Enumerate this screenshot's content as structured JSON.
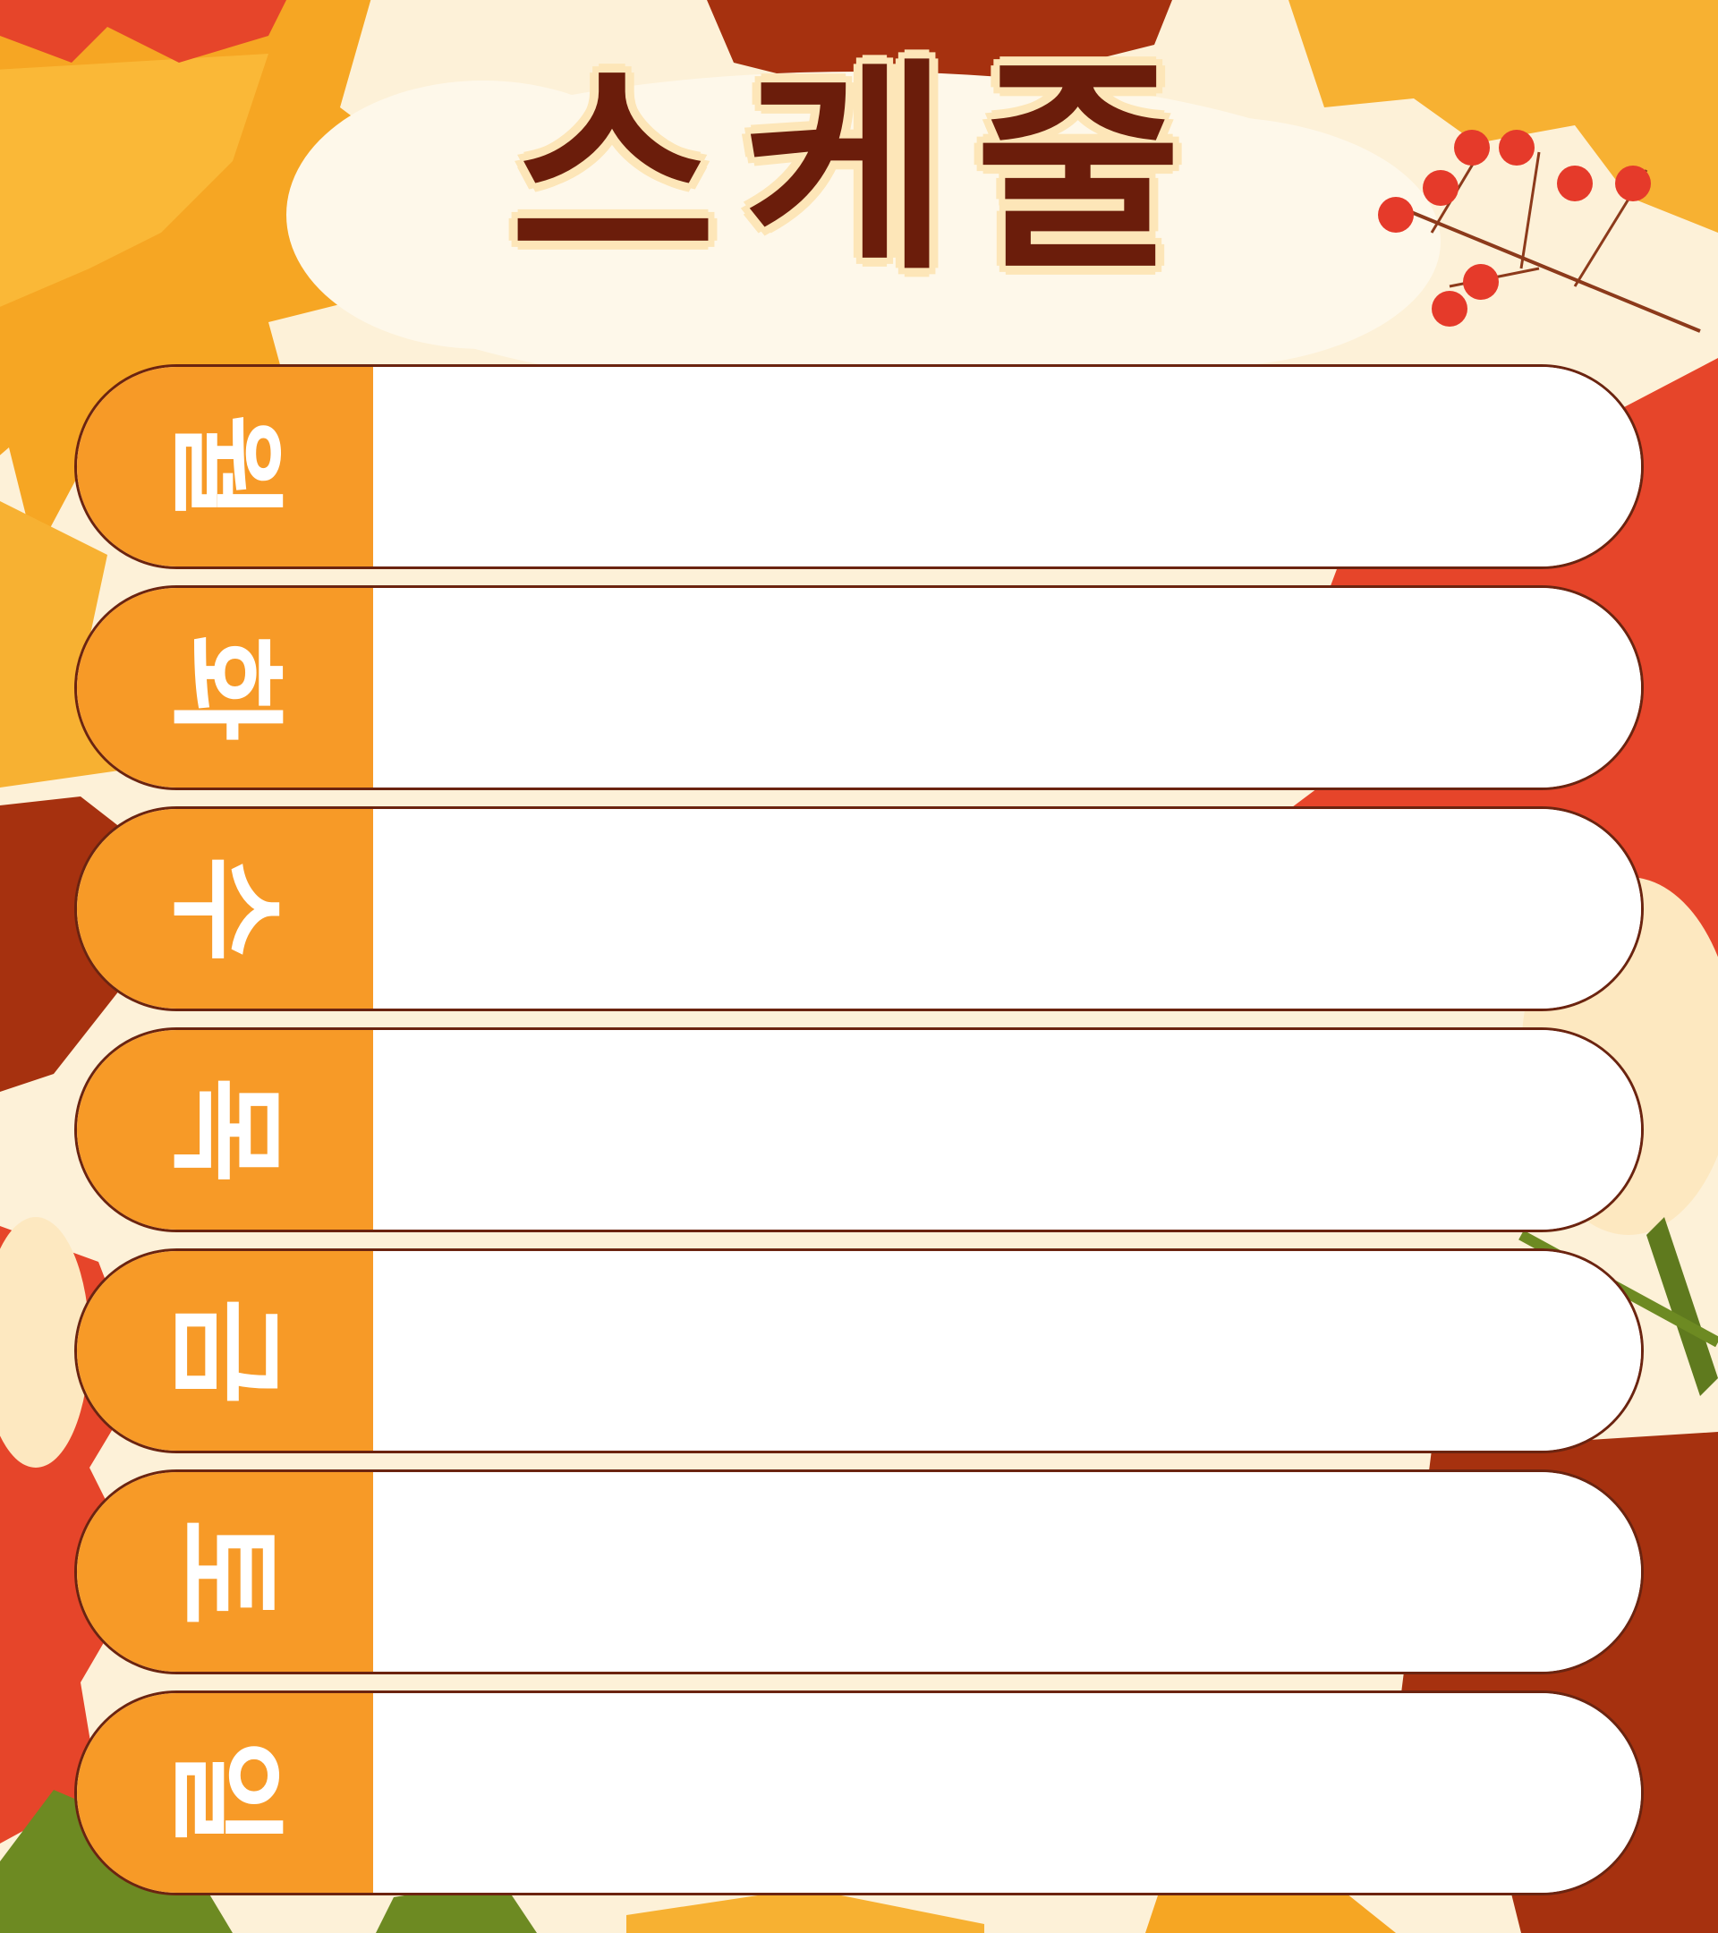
{
  "title": "스케줄",
  "days": [
    {
      "label": "월"
    },
    {
      "label": "화"
    },
    {
      "label": "수"
    },
    {
      "label": "목"
    },
    {
      "label": "금"
    },
    {
      "label": "토"
    },
    {
      "label": "일"
    }
  ],
  "colors": {
    "background": "#fdf1d8",
    "day_tab": "#f79a27",
    "outline": "#6b2410",
    "title": "#6b1d0b",
    "entry": "#ffffff"
  }
}
